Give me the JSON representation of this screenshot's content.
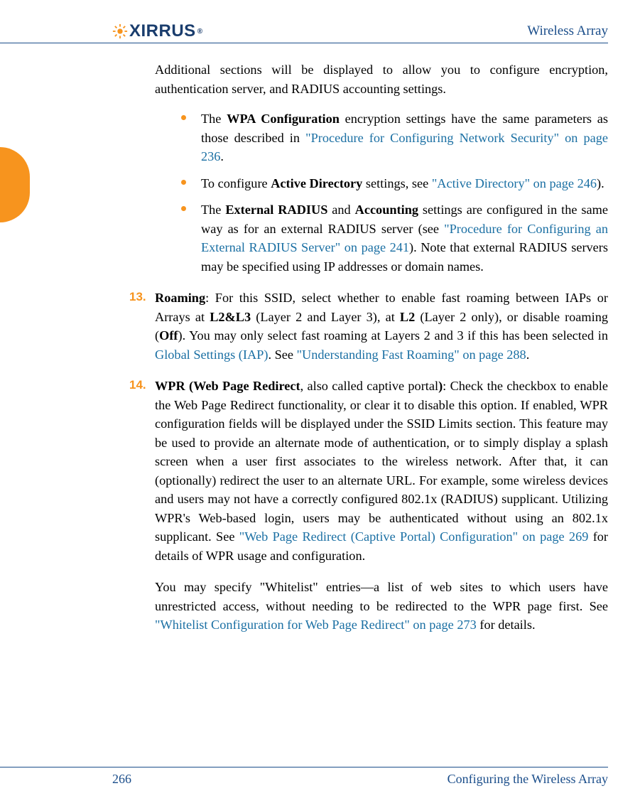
{
  "header": {
    "logo_text": "XIRRUS",
    "logo_reg": "®",
    "title": "Wireless Array"
  },
  "intro": "Additional sections will be displayed to allow you to configure encryption, authentication server, and RADIUS accounting settings.",
  "sub_items": [
    {
      "pre": "The ",
      "bold": "WPA Configuration",
      "mid": " encryption settings have the same parameters as those described in ",
      "link": "\"Procedure for Configuring Network Security\" on page 236",
      "post": "."
    },
    {
      "pre": "To configure ",
      "bold": "Active Directory",
      "mid": " settings, see ",
      "link": "\"Active Directory\" on page 246",
      "post": ")."
    },
    {
      "pre": "The ",
      "bold": "External RADIUS",
      "mid": " and ",
      "bold2": "Accounting",
      "mid2": " settings are configured in the same way as for an external RADIUS server (see ",
      "link": "\"Procedure for Configuring an External RADIUS Server\" on page 241",
      "post": "). Note that external RADIUS servers may be specified using IP addresses or domain names."
    }
  ],
  "items": [
    {
      "num": "13.",
      "bold": "Roaming",
      "text1": ": For this SSID, select whether to enable fast roaming between IAPs or Arrays at ",
      "b1": "L2&L3",
      "t2": " (Layer 2 and Layer 3), at ",
      "b2": "L2",
      "t3": " (Layer 2 only), or disable roaming (",
      "b3": "Off",
      "t4": "). You may only select fast roaming at Layers 2 and 3 if this has been selected in ",
      "link1": "Global Settings (IAP)",
      "t5": ". See ",
      "link2": "\"Understanding Fast Roaming\" on page 288",
      "t6": "."
    },
    {
      "num": "14.",
      "bold": "WPR (Web Page Redirect",
      "text1": ", also called captive portal",
      "bold_close": ")",
      "t2": ": Check the checkbox to enable the Web Page Redirect functionality, or clear it to disable this option. If enabled, WPR configuration fields will be displayed under the SSID Limits section. This feature may be used to provide an alternate mode of authentication, or to simply display a splash screen when a user first associates to the wireless network. After that, it can (optionally) redirect the user to an alternate URL. For example, some wireless devices and users may not have a correctly configured 802.1x (RADIUS) supplicant. Utilizing WPR's Web-based login, users may be authenticated without using an 802.1x supplicant. See ",
      "link1": "\"Web Page Redirect (Captive Portal) Configuration\" on page 269",
      "t3": " for details of WPR usage and configuration.",
      "para2_pre": "You may specify \"Whitelist\" entries—a list of web sites to which users have unrestricted access, without needing to be redirected to the WPR page first. See ",
      "para2_link": "\"Whitelist Configuration for Web Page Redirect\" on page 273",
      "para2_post": " for details."
    }
  ],
  "footer": {
    "page": "266",
    "section": "Configuring the Wireless Array"
  }
}
